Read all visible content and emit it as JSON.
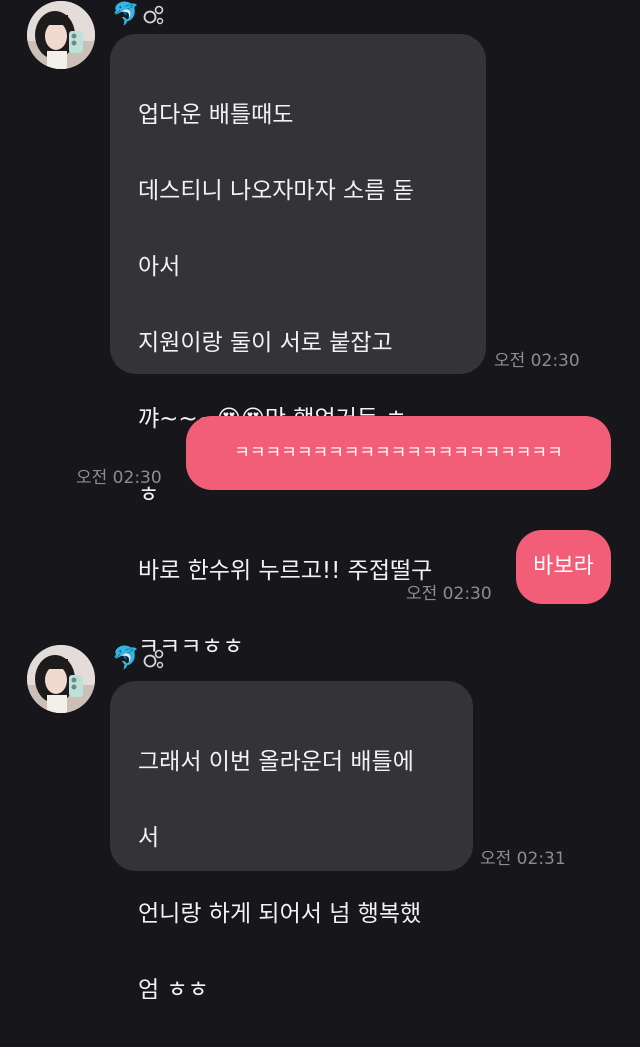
{
  "conversation": {
    "messages": [
      {
        "sender": "other",
        "status_icons": "🐬",
        "lines": [
          "업다운 배틀때도",
          "데스티니 나오자마자 소름 돋",
          "아서",
          "지원이랑 둘이 서로 붙잡고",
          "꺄~~~😍😍만 했었거든 ㅎ",
          "ㅎ",
          "바로 한수위 누르고!! 주접떨구",
          "ㅋㅋㅋㅎㅎ"
        ],
        "time": "오전 02:30"
      },
      {
        "sender": "me",
        "text": "ㅋㅋㅋㅋㅋㅋㅋㅋㅋㅋㅋㅋㅋㅋㅋㅋㅋㅋㅋㅋㅋ",
        "time": "오전 02:30"
      },
      {
        "sender": "me",
        "text": "바보라",
        "time": "오전 02:30"
      },
      {
        "sender": "other",
        "status_icons": "🐬",
        "lines": [
          "그래서 이번 올라운더 배틀에",
          "서",
          "언니랑 하게 되어서 넘 행복했",
          "엄 ㅎㅎ"
        ],
        "time": "오전 02:31"
      }
    ]
  },
  "colors": {
    "background": "#17171b",
    "incoming_bubble": "#333338",
    "outgoing_bubble": "#f25d78",
    "timestamp": "#8c8c91"
  }
}
